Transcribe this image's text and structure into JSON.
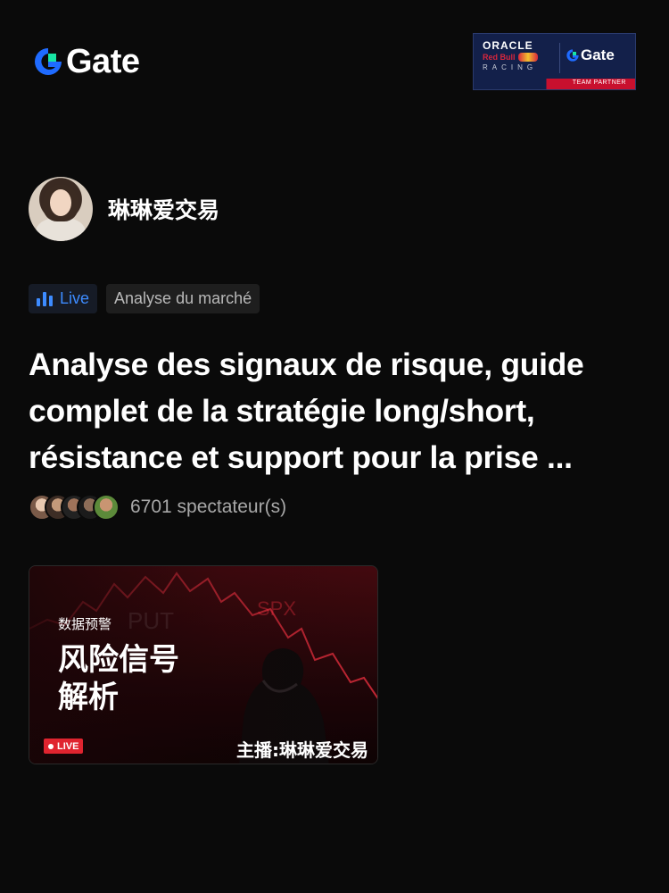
{
  "brand": {
    "logo_text": "Gate",
    "accent": "#1f6bff",
    "accent_green": "#17e5a3"
  },
  "partner_badge": {
    "oracle": "ORACLE",
    "redbull": "Red Bull",
    "racing": "RACING",
    "gate": "Gate",
    "team_partner": "TEAM PARTNER"
  },
  "host": {
    "name": "琳琳爱交易"
  },
  "tags": {
    "live": "Live",
    "category": "Analyse du marché"
  },
  "stream": {
    "title": "Analyse des signaux de risque, guide complet de la stratégie long/short, résistance et support pour la prise ...",
    "viewers": "6701 spectateur(s)"
  },
  "thumbnail": {
    "small_text": "数据预警",
    "big_text_line1": "风险信号",
    "big_text_line2": "解析",
    "live_badge": "LIVE",
    "host_text": "主播:琳琳爱交易"
  },
  "colors": {
    "background": "#0a0a0a",
    "live_blue": "#3d8bff",
    "live_red": "#e0242f"
  }
}
